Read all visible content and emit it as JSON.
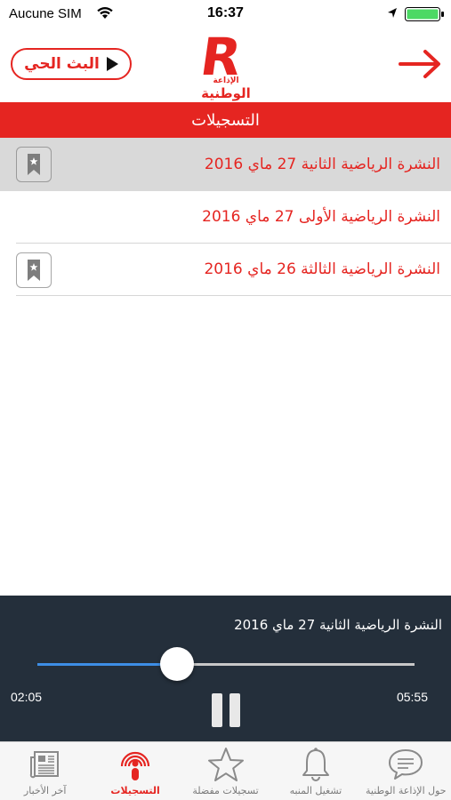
{
  "status_bar": {
    "carrier": "Aucune SIM",
    "time": "16:37",
    "icons": [
      "wifi-icon",
      "location-icon",
      "battery-icon"
    ]
  },
  "header": {
    "live_label": "البث الحي",
    "logo": {
      "letter": "R",
      "line1": "الإذاعة",
      "line2": "الوطنية"
    },
    "forward_icon": "forward-arrow-icon"
  },
  "section": {
    "title": "التسجيلات"
  },
  "recordings": [
    {
      "title": "النشرة الرياضية الثانية 27 ماي 2016",
      "active": true,
      "bookmark": true
    },
    {
      "title": "النشرة الرياضية  الأولى 27 ماي  2016",
      "active": false,
      "bookmark": false
    },
    {
      "title": "النشرة الرياضية  الثالثة 26 ماي 2016",
      "active": false,
      "bookmark": true
    }
  ],
  "player": {
    "now_playing": "النشرة الرياضية الثانية 27 ماي 2016",
    "elapsed": "02:05",
    "total": "05:55",
    "progress": 0.37,
    "state": "playing"
  },
  "tabs": [
    {
      "label": "آخر الأخبار",
      "icon": "newspaper-icon",
      "active": false
    },
    {
      "label": "التسجيلات",
      "icon": "recordings-icon",
      "active": true
    },
    {
      "label": "تسجيلات مفضلة",
      "icon": "star-icon",
      "active": false
    },
    {
      "label": "تشغيل المنبه",
      "icon": "bell-icon",
      "active": false
    },
    {
      "label": "حول الإذاعة الوطنية",
      "icon": "chat-bubble-icon",
      "active": false
    }
  ],
  "colors": {
    "brand_red": "#e52521",
    "player_bg": "#242f3b",
    "progress_blue": "#3d8ee6",
    "battery_green": "#4cd964"
  }
}
